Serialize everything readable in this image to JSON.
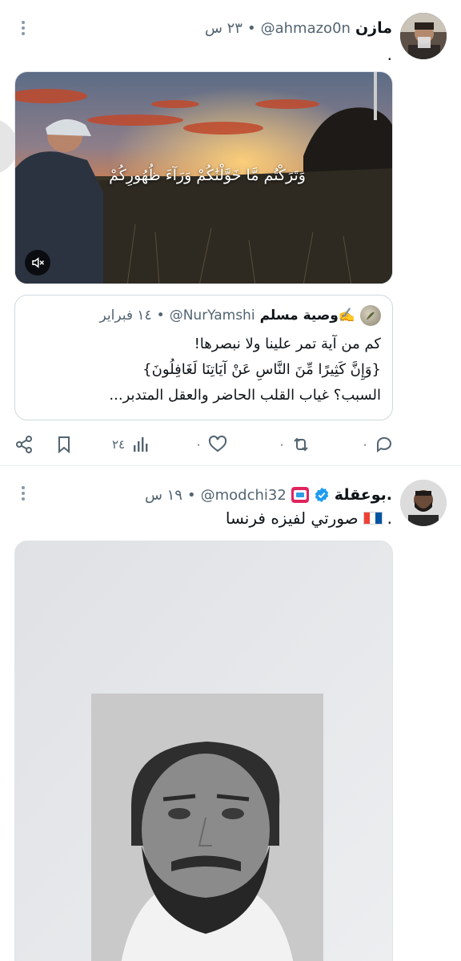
{
  "tweets": [
    {
      "display_name": "مازن",
      "handle": "@ahmazo0n",
      "separator": "•",
      "time": "٢٣ س",
      "text": ".",
      "quote": {
        "display_name": "وصية مسلم✍️",
        "handle": "@NurYamshi",
        "separator": "•",
        "time": "١٤ فبراير",
        "lines": [
          "كم من آية تمر علينا ولا نبصرها!",
          "{وَإِنَّ كَثِيرًا مِّنَ النَّاسِ عَنْ آيَاتِنَا لَغَافِلُونَ}",
          "السبب؟ غياب القلب الحاضر والعقل المتدبر..."
        ]
      },
      "video_caption": "وَتَرَكْتُم مَّا خَوَّلْنَٰكُمْ وَرَآءَ ظُهُورِكُمْ",
      "actions": {
        "reply_count": "٠",
        "retweet_count": "٠",
        "like_count": "٠",
        "views_count": "٢٤"
      }
    },
    {
      "display_name": "بوعقلة.",
      "handle": "@modchi32",
      "separator": "•",
      "time": "١٩ س",
      "text": "صورتي لفيزه فرنسا",
      "text_end": "."
    }
  ],
  "icons": {
    "reply": "reply-icon",
    "retweet": "retweet-icon",
    "like": "heart-icon",
    "views": "views-icon",
    "bookmark": "bookmark-icon",
    "share": "share-icon",
    "mute": "mute-icon",
    "more": "more-icon",
    "verified": "verified-badge-icon",
    "flag": "france-flag-icon"
  },
  "colors": {
    "text": "#0f1419",
    "secondary": "#536471",
    "verified": "#1d9bf0",
    "border": "#cfd9de"
  }
}
